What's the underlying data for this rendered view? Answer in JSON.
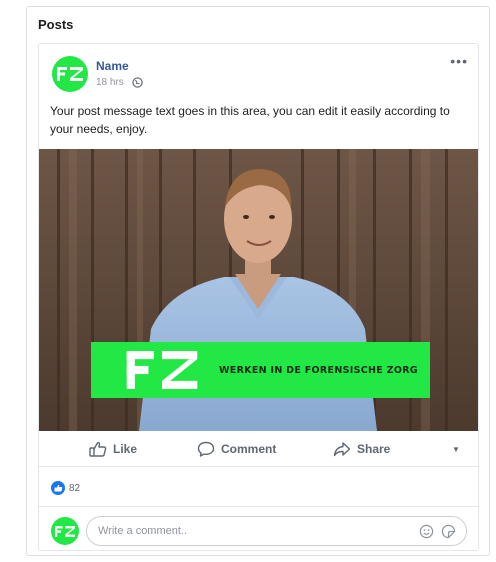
{
  "panel": {
    "title": "Posts"
  },
  "post": {
    "author": "Name",
    "time": "18 hrs",
    "message": "Your post message text goes in this area, you can edit it easily according to your needs, enjoy.",
    "more_label": "•••",
    "banner_text": "WERKEN IN DE FORENSISCHE ZORG",
    "brand_color": "#22e845"
  },
  "actions": {
    "like": "Like",
    "comment": "Comment",
    "share": "Share",
    "dropdown": "▼"
  },
  "reactions": {
    "count": "82"
  },
  "comment_box": {
    "placeholder": "Write a comment.."
  },
  "icons": [
    "globe-icon",
    "more-icon",
    "thumbs-up-icon",
    "comment-bubble-icon",
    "share-arrow-icon",
    "chevron-down-icon",
    "like-reaction-icon",
    "emoji-icon",
    "sticker-icon"
  ]
}
